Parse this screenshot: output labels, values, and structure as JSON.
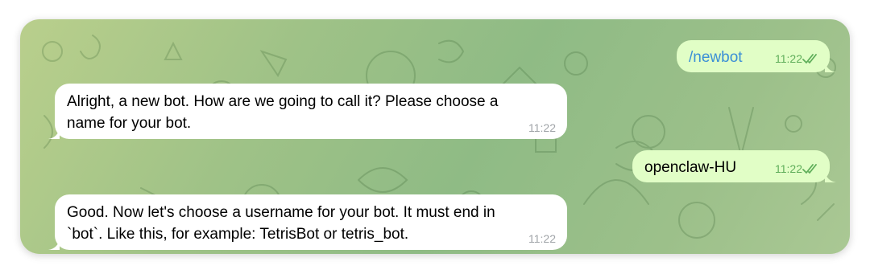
{
  "messages": [
    {
      "direction": "outgoing",
      "text": "/newbot",
      "time": "11:22",
      "status": "read"
    },
    {
      "direction": "incoming",
      "line1": "Alright, a new bot. How are we going to call it? Please choose a",
      "line2": "name for your bot.",
      "time": "11:22"
    },
    {
      "direction": "outgoing",
      "text": "openclaw-HU",
      "time": "11:22",
      "status": "read"
    },
    {
      "direction": "incoming",
      "line1": "Good. Now let's choose a username for your bot. It must end in",
      "line2": "`bot`. Like this, for example: TetrisBot or tetris_bot.",
      "time": "11:22"
    }
  ],
  "colors": {
    "incoming_bubble": "#ffffff",
    "outgoing_bubble": "#e1fec6",
    "command_link": "#3a8fd6",
    "outgoing_time": "#5fae5a",
    "incoming_time": "#a0a4a8",
    "background": "#9fc287"
  },
  "icons": {
    "read_status": "double-check-icon",
    "background": "doodle-pattern"
  }
}
